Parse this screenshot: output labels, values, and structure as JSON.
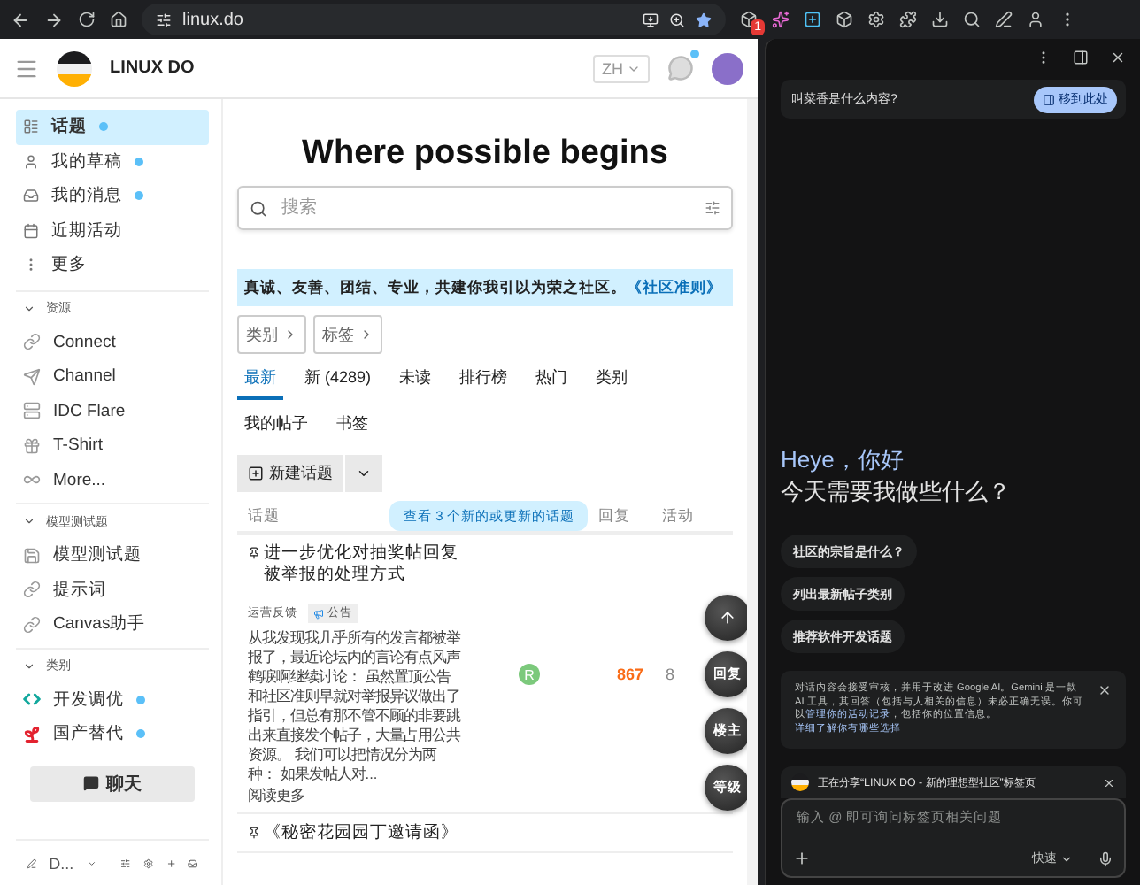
{
  "browser": {
    "url": "linux.do",
    "extension_badge": "1"
  },
  "header": {
    "site_name": "LINUX DO",
    "language": "ZH",
    "chat_unread": true
  },
  "sidebar": {
    "main_items": [
      {
        "label": "话题",
        "selected": true,
        "unread": true
      },
      {
        "label": "我的草稿",
        "selected": false,
        "unread": true
      },
      {
        "label": "我的消息",
        "selected": false,
        "unread": true
      },
      {
        "label": "近期活动",
        "selected": false,
        "unread": false
      },
      {
        "label": "更多",
        "selected": false,
        "unread": false
      }
    ],
    "sections": [
      {
        "title": "资源",
        "expanded": true,
        "items": [
          {
            "label": "Connect",
            "unread": false
          },
          {
            "label": "Channel",
            "unread": false
          },
          {
            "label": "IDC Flare",
            "unread": false
          },
          {
            "label": "T-Shirt",
            "unread": false
          },
          {
            "label": "More...",
            "unread": false
          }
        ]
      },
      {
        "title": "模型测试题",
        "expanded": true,
        "items": [
          {
            "label": "模型测试题",
            "unread": false
          },
          {
            "label": "提示词",
            "unread": false
          },
          {
            "label": "Canvas助手",
            "unread": false
          }
        ]
      },
      {
        "title": "类别",
        "expanded": true,
        "items": [
          {
            "label": "开发调优",
            "unread": true,
            "color": "#12a89d"
          },
          {
            "label": "国产替代",
            "unread": true,
            "color": "#e3222f"
          }
        ]
      }
    ],
    "chat_button": "聊天",
    "footer_label": "D..."
  },
  "main": {
    "title": "Where possible begins",
    "search": {
      "placeholder": "搜索"
    },
    "banner": {
      "text": "真诚、友善、团结、专业，共建你我引以为荣之社区。",
      "link": "《社区准则》"
    },
    "filters": [
      "类别",
      "标签"
    ],
    "nav": [
      {
        "label": "最新",
        "selected": true
      },
      {
        "label": "新 (4289)",
        "selected": false
      },
      {
        "label": "未读",
        "selected": false
      },
      {
        "label": "排行榜",
        "selected": false
      },
      {
        "label": "热门",
        "selected": false
      },
      {
        "label": "类别",
        "selected": false
      },
      {
        "label": "我的帖子",
        "selected": false
      },
      {
        "label": "书签",
        "selected": false
      }
    ],
    "new_topic_button": "新建话题",
    "table": {
      "columns": [
        "话题",
        "回复",
        "活动"
      ],
      "new_topics_pill": "查看 3 个新的或更新的话题",
      "rows": [
        {
          "title": "进一步优化对抽奖帖回复被举报的处理方式",
          "pinned": true,
          "category": "运营反馈",
          "tag": "公告",
          "excerpt": "从我发现我几乎所有的发言都被举报了，最近论坛内的言论有点风声鹤唳啊继续讨论： 虽然置顶公告和社区准则早就对举报异议做出了指引，但总有那不管不顾的非要跳出来直接发个帖子，大量占用公共资源。 我们可以把情况分为两种： 如果发帖人对...",
          "read_more": "阅读更多",
          "poster_initial": "R",
          "replies": "867",
          "activity": "8"
        },
        {
          "title": "《秘密花园园丁邀请函》",
          "pinned": true
        }
      ]
    },
    "floating_buttons": [
      "回复",
      "楼主",
      "等级"
    ]
  },
  "assistant": {
    "prompt_card": {
      "text": "叫菜香是什么内容?",
      "button": "移到此处"
    },
    "greeting_name": "Heye，你好",
    "greeting_question": "今天需要我做些什么？",
    "suggestions": [
      "社区的宗旨是什么？",
      "列出最新帖子类别",
      "推荐软件开发话题"
    ],
    "notice": [
      {
        "kind": "text",
        "text": "对话内容会接受审核，并用于改进 Google AI。Gemini 是一款 AI 工具，其回答（包括与人相关的信息）未必正确无误。你可以"
      },
      {
        "kind": "link",
        "text": "管理你的活动记录"
      },
      {
        "kind": "text",
        "text": "，包括你的位置信息。"
      },
      {
        "kind": "link",
        "text": "详细了解你有哪些选择"
      }
    ],
    "sharing": "正在分享“LINUX DO - 新的理想型社区”标签页",
    "input": {
      "placeholder": "输入 @ 即可询问标签页相关问题"
    },
    "mode": "快速"
  }
}
